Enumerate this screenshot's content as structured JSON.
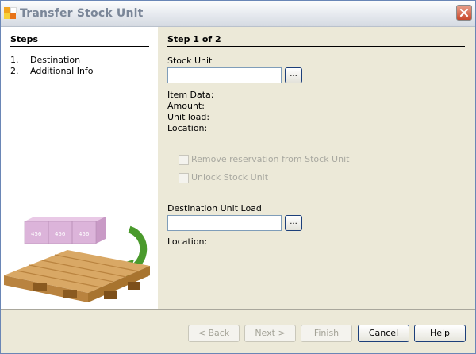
{
  "window": {
    "title": "Transfer Stock Unit"
  },
  "steps": {
    "title": "Steps",
    "items": [
      {
        "num": "1.",
        "label": "Destination"
      },
      {
        "num": "2.",
        "label": "Additional Info"
      }
    ]
  },
  "illustration": {
    "box_labels": [
      "456",
      "456",
      "456"
    ]
  },
  "main": {
    "step_header": "Step 1 of 2",
    "stock_unit": {
      "label": "Stock Unit",
      "value": "",
      "browse": "..."
    },
    "info": {
      "item_data": "Item Data:",
      "amount": "Amount:",
      "unit_load": "Unit load:",
      "location": "Location:"
    },
    "options": {
      "remove_reservation": "Remove reservation from Stock Unit",
      "unlock": "Unlock Stock Unit"
    },
    "destination": {
      "label": "Destination Unit Load",
      "value": "",
      "browse": "...",
      "location": "Location:"
    }
  },
  "buttons": {
    "back": "< Back",
    "next": "Next >",
    "finish": "Finish",
    "cancel": "Cancel",
    "help": "Help"
  }
}
